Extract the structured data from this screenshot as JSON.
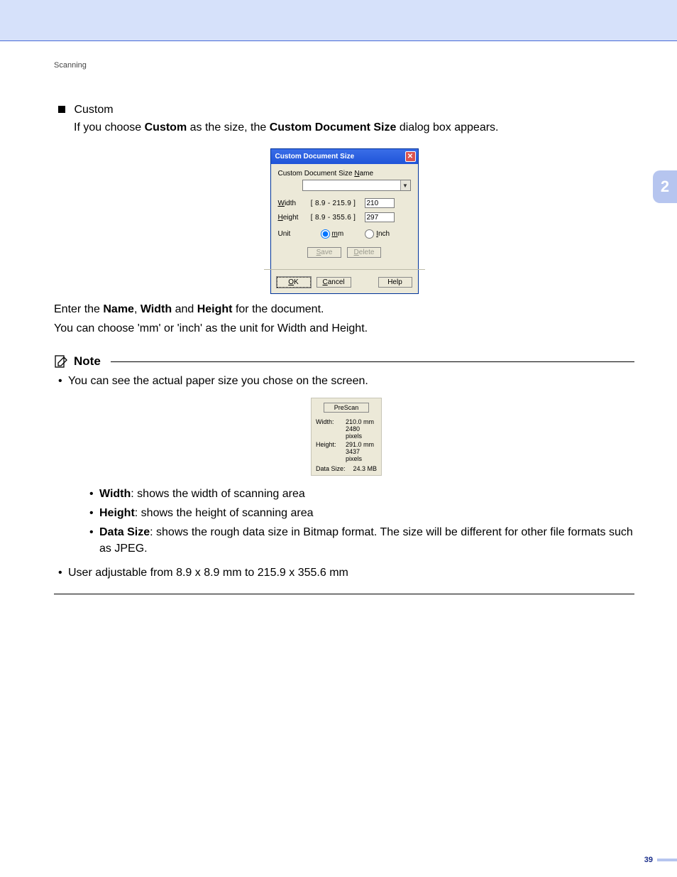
{
  "breadcrumb": "Scanning",
  "side_tab": "2",
  "page_number": "39",
  "section": {
    "heading": "Custom",
    "intro_before": "If you choose ",
    "intro_b1": "Custom",
    "intro_mid": " as the size, the ",
    "intro_b2": "Custom Document Size",
    "intro_after": " dialog box appears."
  },
  "dialog": {
    "title": "Custom Document Size",
    "name_label_pre": "Custom Document Size ",
    "name_label_u": "N",
    "name_label_post": "ame",
    "width_u": "W",
    "width_post": "idth",
    "width_range": "[  8.9 - 215.9 ]",
    "width_value": "210",
    "height_u": "H",
    "height_post": "eight",
    "height_range": "[  8.9 - 355.6 ]",
    "height_value": "297",
    "unit_label": "Unit",
    "unit_mm_u": "m",
    "unit_mm_post": "m",
    "unit_inch_u": "I",
    "unit_inch_post": "nch",
    "btn_save_u": "S",
    "btn_save_post": "ave",
    "btn_delete_u": "D",
    "btn_delete_post": "elete",
    "btn_ok_u": "O",
    "btn_ok_post": "K",
    "btn_cancel_u": "C",
    "btn_cancel_post": "ancel",
    "btn_help": "Help"
  },
  "after_dialog": {
    "line1_pre": "Enter the ",
    "line1_b1": "Name",
    "line1_mid1": ", ",
    "line1_b2": "Width",
    "line1_mid2": " and ",
    "line1_b3": "Height",
    "line1_post": " for the document.",
    "line2": "You can choose 'mm' or 'inch' as the unit for Width and Height."
  },
  "note": {
    "title": "Note",
    "intro": "You can see the actual paper size you chose on the screen.",
    "prescan": {
      "btn_pre": "P",
      "btn_u": "r",
      "btn_post": "eScan",
      "width_label": "Width:",
      "width_val": "210.0 mm",
      "width_px": "2480 pixels",
      "height_label": "Height:",
      "height_val": "291.0 mm",
      "height_px": "3437 pixels",
      "datasize_label": "Data Size:",
      "datasize_val": "24.3 MB"
    },
    "bullets": {
      "b1_key": "Width",
      "b1_text": ": shows the width of scanning area",
      "b2_key": "Height",
      "b2_text": ": shows the height of scanning area",
      "b3_key": "Data Size",
      "b3_text": ": shows the rough data size in Bitmap format. The size will be different for other file formats such as JPEG."
    },
    "range_text": "User adjustable from 8.9 x 8.9 mm to 215.9 x 355.6 mm"
  }
}
